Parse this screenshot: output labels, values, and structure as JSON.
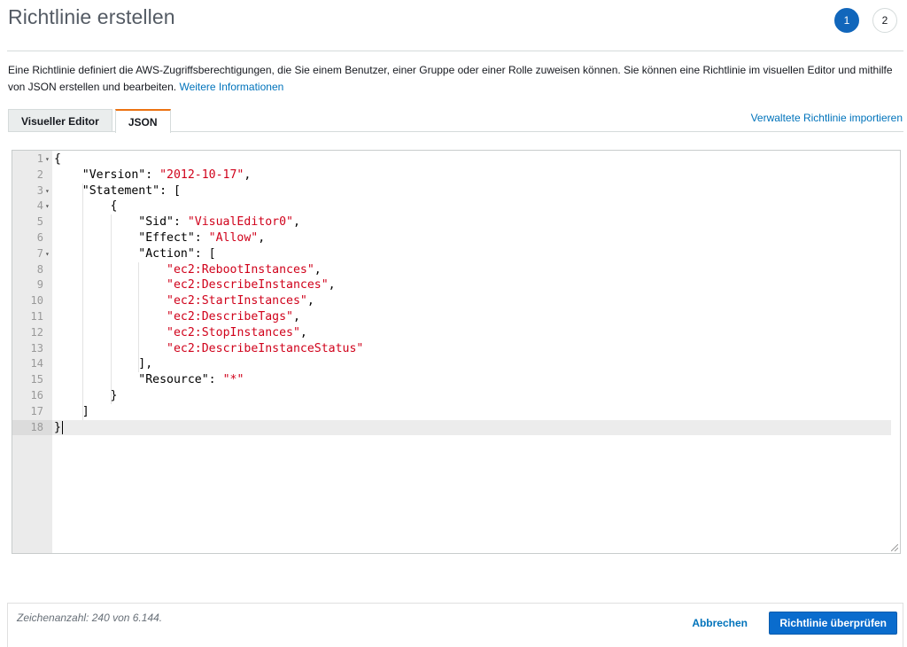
{
  "page": {
    "title": "Richtlinie erstellen",
    "steps": [
      "1",
      "2"
    ],
    "description": "Eine Richtlinie definiert die AWS-Zugriffsberechtigungen, die Sie einem Benutzer, einer Gruppe oder einer Rolle zuweisen können. Sie können eine Richtlinie im visuellen Editor und mithilfe von JSON erstellen und bearbeiten. ",
    "learn_more": "Weitere Informationen"
  },
  "tabs": {
    "visual": "Visueller Editor",
    "json": "JSON"
  },
  "import_link": "Verwaltete Richtlinie importieren",
  "editor": {
    "lines": [
      {
        "n": "1",
        "fold": true,
        "parts": [
          [
            "p",
            "{"
          ]
        ]
      },
      {
        "n": "2",
        "fold": false,
        "parts": [
          [
            "p",
            "    \"Version\": "
          ],
          [
            "s",
            "\"2012-10-17\""
          ],
          [
            "p",
            ","
          ]
        ]
      },
      {
        "n": "3",
        "fold": true,
        "parts": [
          [
            "p",
            "    \"Statement\": ["
          ]
        ]
      },
      {
        "n": "4",
        "fold": true,
        "parts": [
          [
            "p",
            "        {"
          ]
        ]
      },
      {
        "n": "5",
        "fold": false,
        "parts": [
          [
            "p",
            "            \"Sid\": "
          ],
          [
            "s",
            "\"VisualEditor0\""
          ],
          [
            "p",
            ","
          ]
        ]
      },
      {
        "n": "6",
        "fold": false,
        "parts": [
          [
            "p",
            "            \"Effect\": "
          ],
          [
            "s",
            "\"Allow\""
          ],
          [
            "p",
            ","
          ]
        ]
      },
      {
        "n": "7",
        "fold": true,
        "parts": [
          [
            "p",
            "            \"Action\": ["
          ]
        ]
      },
      {
        "n": "8",
        "fold": false,
        "parts": [
          [
            "p",
            "                "
          ],
          [
            "s",
            "\"ec2:RebootInstances\""
          ],
          [
            "p",
            ","
          ]
        ]
      },
      {
        "n": "9",
        "fold": false,
        "parts": [
          [
            "p",
            "                "
          ],
          [
            "s",
            "\"ec2:DescribeInstances\""
          ],
          [
            "p",
            ","
          ]
        ]
      },
      {
        "n": "10",
        "fold": false,
        "parts": [
          [
            "p",
            "                "
          ],
          [
            "s",
            "\"ec2:StartInstances\""
          ],
          [
            "p",
            ","
          ]
        ]
      },
      {
        "n": "11",
        "fold": false,
        "parts": [
          [
            "p",
            "                "
          ],
          [
            "s",
            "\"ec2:DescribeTags\""
          ],
          [
            "p",
            ","
          ]
        ]
      },
      {
        "n": "12",
        "fold": false,
        "parts": [
          [
            "p",
            "                "
          ],
          [
            "s",
            "\"ec2:StopInstances\""
          ],
          [
            "p",
            ","
          ]
        ]
      },
      {
        "n": "13",
        "fold": false,
        "parts": [
          [
            "p",
            "                "
          ],
          [
            "s",
            "\"ec2:DescribeInstanceStatus\""
          ]
        ]
      },
      {
        "n": "14",
        "fold": false,
        "parts": [
          [
            "p",
            "            ],"
          ]
        ]
      },
      {
        "n": "15",
        "fold": false,
        "parts": [
          [
            "p",
            "            \"Resource\": "
          ],
          [
            "s",
            "\"*\""
          ]
        ]
      },
      {
        "n": "16",
        "fold": false,
        "parts": [
          [
            "p",
            "        }"
          ]
        ]
      },
      {
        "n": "17",
        "fold": false,
        "parts": [
          [
            "p",
            "    ]"
          ]
        ]
      },
      {
        "n": "18",
        "fold": false,
        "parts": [
          [
            "p",
            "}"
          ]
        ]
      }
    ],
    "active_line": 18
  },
  "footer": {
    "char_count": "Zeichenanzahl: 240 von 6.144.",
    "cancel": "Abbrechen",
    "review": "Richtlinie überprüfen"
  },
  "colors": {
    "accent": "#0a6ccd",
    "tab_active_border": "#ec7211",
    "string": "#d0021b",
    "link": "#0073bb"
  }
}
